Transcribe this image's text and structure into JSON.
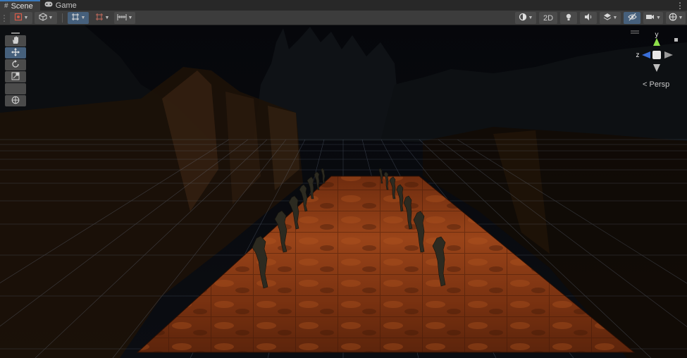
{
  "tabs": [
    {
      "label": "Scene",
      "icon": "hash-icon",
      "active": true
    },
    {
      "label": "Game",
      "icon": "gamepad-icon",
      "active": false
    }
  ],
  "toolbar": {
    "draw_mode_label": "2D"
  },
  "gizmo": {
    "y_label": "y",
    "z_label": "z",
    "projection_label": "Persp"
  },
  "colors": {
    "panel": "#3c3c3c",
    "tab_bar": "#282828",
    "active_button": "#46607c",
    "gizmo_y": "#8ee04a",
    "gizmo_z": "#3a6fd8",
    "floor": "#8a3a12"
  }
}
